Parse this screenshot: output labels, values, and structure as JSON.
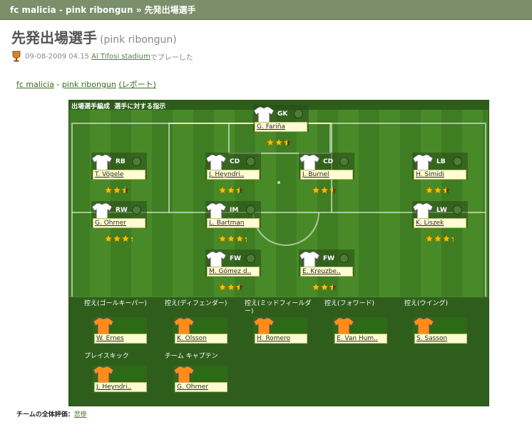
{
  "titlebar": {
    "team_a": "fc malicia",
    "sep1": " - ",
    "team_b": "pink ribongun",
    "sep2": " » ",
    "page": "先発出場選手"
  },
  "heading": {
    "title": "先発出場選手",
    "subtitle": "(pink ribongun)"
  },
  "meta": {
    "datetime": "09-08-2009 04.15",
    "stadium": "Al Tifosi stadium",
    "suffix": "でプレーした"
  },
  "links": {
    "home": "fc malicia",
    "dash": " - ",
    "away": "pink ribongun",
    "report": "(レポート)"
  },
  "pitch_header": {
    "left": "出場選手編成",
    "right": "選手に対する指示"
  },
  "players": [
    {
      "pos": "GK",
      "name": "G. Fariña",
      "stars": 2.5
    },
    {
      "pos": "RB",
      "name": "T. Vögele",
      "stars": 2.5
    },
    {
      "pos": "CD",
      "name": "J. Heyndri..",
      "stars": 2.5
    },
    {
      "pos": "CD",
      "name": "J. Burnel",
      "stars": 2.5
    },
    {
      "pos": "LB",
      "name": "H. Simidi",
      "stars": 2.5
    },
    {
      "pos": "RW",
      "name": "G. Ohrner",
      "stars": 3.5
    },
    {
      "pos": "IM",
      "name": "L. Bartman",
      "stars": 3.5
    },
    {
      "pos": "LW",
      "name": "K. Liszek",
      "stars": 3.5
    },
    {
      "pos": "FW",
      "name": "M. Gómez d..",
      "stars": 2.5
    },
    {
      "pos": "FW",
      "name": "E. Kreuzbe..",
      "stars": 2.5
    }
  ],
  "bench": [
    {
      "label": "控え(ゴールキーパー)",
      "name": "W. Ernes"
    },
    {
      "label": "控え(ディフェンダー)",
      "name": "K. Olsson"
    },
    {
      "label": "控え(ミッドフィールダー)",
      "name": "H. Romero"
    },
    {
      "label": "控え(フォワード)",
      "name": "E. Van Hum.."
    },
    {
      "label": "控え(ウイング)",
      "name": "S. Sasson"
    },
    {
      "label": "プレイスキック",
      "name": "J. Heyndri.."
    },
    {
      "label": "チーム キャプテン",
      "name": "G. Ohrner"
    }
  ],
  "rating": {
    "label": "チームの全体評価：",
    "value": "悲惨"
  },
  "colors": {
    "shirt_home": "#ffffff",
    "shirt_bench": "#ff8c1a",
    "star": "#f6c000"
  }
}
